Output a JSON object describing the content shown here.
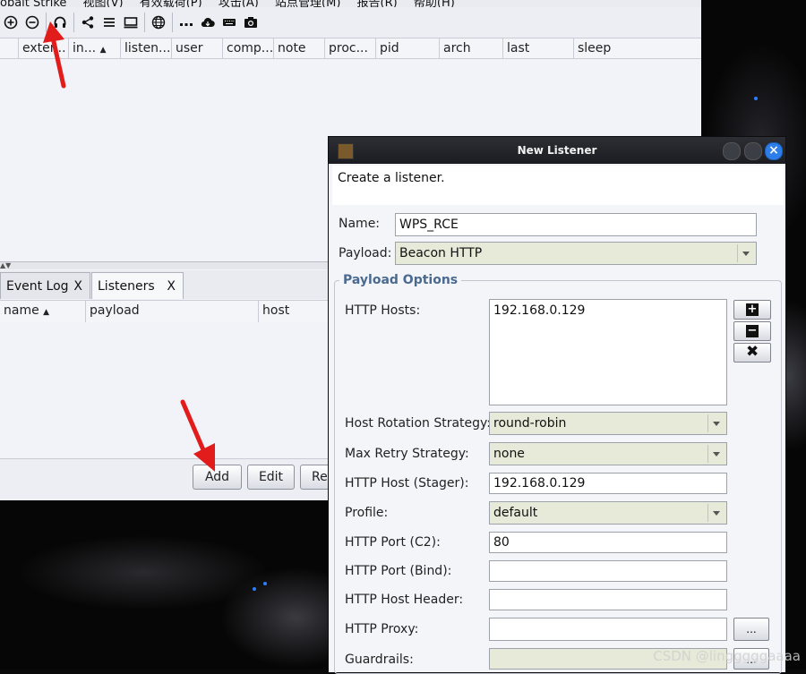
{
  "menubar": {
    "items": [
      "obalt Strike",
      "视图(V)",
      "有效载荷(P)",
      "攻击(A)",
      "站点管理(M)",
      "报告(R)",
      "帮助(H)"
    ]
  },
  "toolbar": {
    "icons": [
      "add-circle-icon",
      "remove-circle-icon",
      "headphones-icon",
      "share-icon",
      "list-icon",
      "monitor-icon",
      "globe-icon",
      "dots-icon",
      "cloud-icon",
      "keyboard-icon",
      "camera-icon"
    ]
  },
  "beacon_table": {
    "columns": [
      "exter...",
      "in...",
      "listen...",
      "user",
      "comp...",
      "note",
      "proc...",
      "pid",
      "arch",
      "last",
      "sleep"
    ]
  },
  "tabs": [
    {
      "label": "Event Log",
      "close": "X"
    },
    {
      "label": "Listeners",
      "close": "X"
    }
  ],
  "listener_table": {
    "columns": [
      "name",
      "payload",
      "host"
    ]
  },
  "buttons": {
    "add": "Add",
    "edit": "Edit",
    "re": "Re"
  },
  "dialog": {
    "title": "New Listener",
    "description": "Create a listener.",
    "name_label": "Name:",
    "name_value": "WPS_RCE",
    "payload_label": "Payload:",
    "payload_value": "Beacon HTTP",
    "group_title": "Payload Options",
    "http_hosts_label": "HTTP Hosts:",
    "http_hosts_value": "192.168.0.129",
    "rotation_label": "Host Rotation Strategy:",
    "rotation_value": "round-robin",
    "retry_label": "Max Retry Strategy:",
    "retry_value": "none",
    "stager_label": "HTTP Host (Stager):",
    "stager_value": "192.168.0.129",
    "profile_label": "Profile:",
    "profile_value": "default",
    "port_c2_label": "HTTP Port (C2):",
    "port_c2_value": "80",
    "port_bind_label": "HTTP Port (Bind):",
    "port_bind_value": "",
    "host_header_label": "HTTP Host Header:",
    "host_header_value": "",
    "proxy_label": "HTTP Proxy:",
    "proxy_value": "",
    "guardrails_label": "Guardrails:",
    "ellipsis": "..."
  },
  "watermark": "CSDN @lingggggaaaa"
}
